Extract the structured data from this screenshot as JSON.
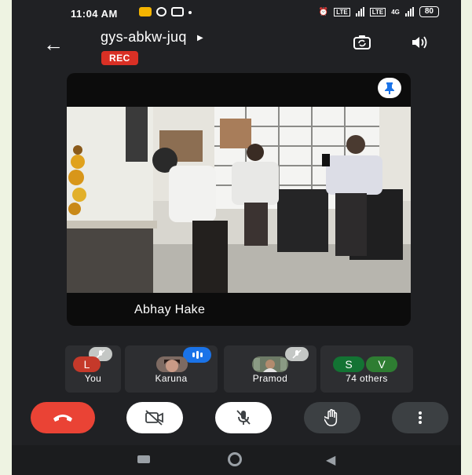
{
  "status_bar": {
    "time": "11:04 AM",
    "battery": "80",
    "network": "4G"
  },
  "header": {
    "meeting_code": "gys-abkw-juq",
    "rec_badge": "REC",
    "back_icon": "arrow-left-icon",
    "camera_switch_icon": "camera-flip-icon",
    "audio_output_icon": "speaker-icon"
  },
  "main_tile": {
    "speaker_name": "Abhay Hake",
    "pin_icon": "pin-icon"
  },
  "participants": [
    {
      "label": "You",
      "avatar_letter": "L",
      "avatar_color": "#c5392a",
      "mic": "muted"
    },
    {
      "label": "Karuna",
      "avatar_letter": "",
      "mic": "speaking"
    },
    {
      "label": "Pramod",
      "avatar_letter": "",
      "mic": "muted"
    },
    {
      "label": "74 others",
      "avatar_letters": [
        "S",
        "V"
      ],
      "avatar_colors": [
        "#137333",
        "#2e7d32"
      ]
    }
  ],
  "controls": [
    {
      "name": "end-call",
      "icon": "phone-hangup-icon",
      "color": "#ea4335"
    },
    {
      "name": "camera",
      "icon": "camera-off-icon",
      "color": "#ffffff"
    },
    {
      "name": "microphone",
      "icon": "mic-off-icon",
      "color": "#ffffff"
    },
    {
      "name": "raise-hand",
      "icon": "hand-icon",
      "color": "#3c4043"
    },
    {
      "name": "more",
      "icon": "more-vertical-icon",
      "color": "#3c4043"
    }
  ],
  "colors": {
    "background": "#202124",
    "rec_red": "#d93025",
    "speaking_blue": "#1a73e8"
  }
}
